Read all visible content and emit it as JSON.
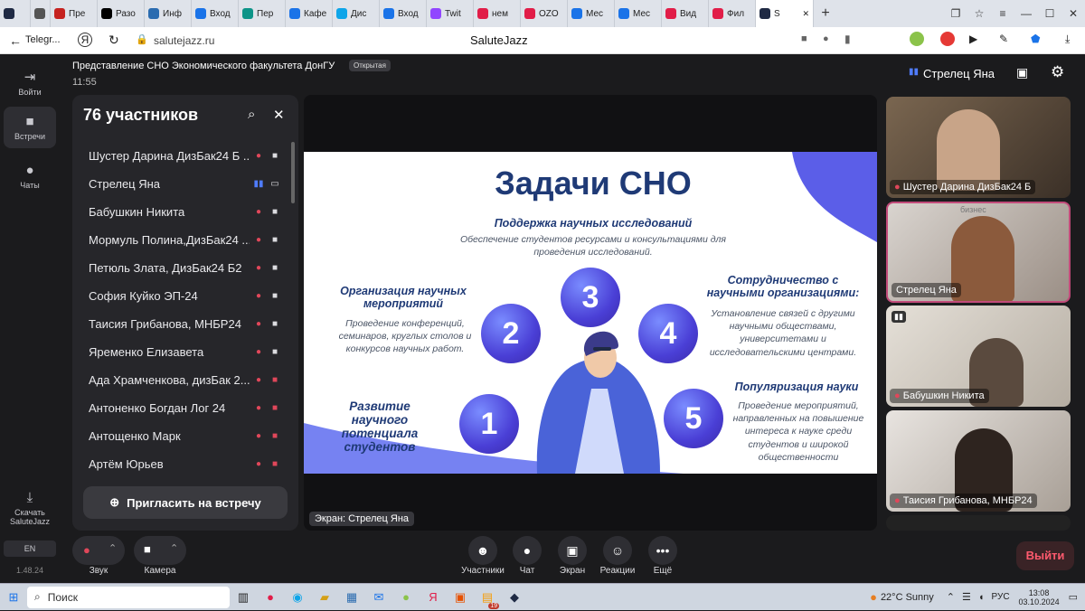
{
  "browser": {
    "tabs": [
      {
        "label": "",
        "color": "#1f2a44"
      },
      {
        "label": "",
        "color": "#555555"
      },
      {
        "label": "Пре",
        "color": "#c5221f"
      },
      {
        "label": "Разо",
        "color": "#000000"
      },
      {
        "label": "Инф",
        "color": "#2b6cb0"
      },
      {
        "label": "Вход",
        "color": "#1a73e8"
      },
      {
        "label": "Пер",
        "color": "#0d9488"
      },
      {
        "label": "Кафе",
        "color": "#1a73e8"
      },
      {
        "label": "Дис",
        "color": "#0ea5e9"
      },
      {
        "label": "Вход",
        "color": "#1a73e8"
      },
      {
        "label": "Twit",
        "color": "#9146ff"
      },
      {
        "label": "нем",
        "color": "#e11d48"
      },
      {
        "label": "OZO",
        "color": "#e11d48"
      },
      {
        "label": "Мес",
        "color": "#1a73e8"
      },
      {
        "label": "Мес",
        "color": "#1a73e8"
      },
      {
        "label": "Вид",
        "color": "#e11d48"
      },
      {
        "label": "Фил",
        "color": "#e11d48"
      },
      {
        "label": "S",
        "color": "#1f2a44"
      }
    ],
    "back_label": "Telegr...",
    "url": "salutejazz.ru",
    "page_title": "SaluteJazz"
  },
  "meeting": {
    "title": "Представление СНО Экономического факультета ДонГУ",
    "badge": "Открытая",
    "time": "11:55",
    "presenter_name": "Стрелец Яна"
  },
  "rail": {
    "leave": "Войти",
    "meetings": "Встречи",
    "chats": "Чаты",
    "download": "Скачать SaluteJazz",
    "lang": "EN",
    "version": "1.48.24"
  },
  "participants": {
    "title": "76 участников",
    "invite": "Пригласить на встречу",
    "list": [
      {
        "name": "Шустер Дарина ДизБак24 Б ...",
        "mic": "off",
        "cam": "on"
      },
      {
        "name": "Стрелец Яна",
        "mic": "on",
        "cam": "screen"
      },
      {
        "name": "Бабушкин Никита",
        "mic": "off",
        "cam": "on"
      },
      {
        "name": "Мормуль Полина,ДизБак24 ...",
        "mic": "off",
        "cam": "on"
      },
      {
        "name": "Петюль Злата, ДизБак24 Б2",
        "mic": "off",
        "cam": "on"
      },
      {
        "name": "София Куйко ЭП-24",
        "mic": "off",
        "cam": "on"
      },
      {
        "name": "Таисия Грибанова, МНБР24",
        "mic": "off",
        "cam": "on"
      },
      {
        "name": "Яременко Елизавета",
        "mic": "off",
        "cam": "on"
      },
      {
        "name": "Ада Храмченкова, дизБак 2...",
        "mic": "off",
        "cam": "off"
      },
      {
        "name": "Антоненко Богдан Лог 24",
        "mic": "off",
        "cam": "off"
      },
      {
        "name": "Антощенко Марк",
        "mic": "off",
        "cam": "off"
      },
      {
        "name": "Артём Юрьев",
        "mic": "off",
        "cam": "off"
      }
    ]
  },
  "slide": {
    "title": "Задачи СНО",
    "i1_h": "Развитие научного потенциала студентов",
    "i2_h": "Организация научных мероприятий",
    "i2_t": "Проведение конференций, семинаров, круглых столов и конкурсов научных работ.",
    "i3_h": "Поддержка научных исследований",
    "i3_t": "Обеспечение студентов ресурсами и консультациями для проведения исследований.",
    "i4_h": "Сотрудничество с научными организациями:",
    "i4_t": "Установление связей с другими научными обществами, университетами и исследовательскими центрами.",
    "i5_h": "Популяризация науки",
    "i5_t": "Проведение мероприятий, направленных на повышение интереса к науке среди студентов и широкой общественности",
    "n1": "1",
    "n2": "2",
    "n3": "3",
    "n4": "4",
    "n5": "5"
  },
  "stage_label": "Экран: Стрелец Яна",
  "tiles": [
    {
      "name": "Шустер Дарина ДизБак24 Б"
    },
    {
      "name": "Стрелец Яна"
    },
    {
      "name": "Бабушкин Никита"
    },
    {
      "name": "Таисия Грибанова, МНБР24"
    }
  ],
  "tile_bg_text": "бизнес",
  "controls": {
    "sound": "Звук",
    "camera": "Камера",
    "participants": "Участники",
    "chat": "Чат",
    "screen": "Экран",
    "reactions": "Реакции",
    "more": "Ещё",
    "exit": "Выйти"
  },
  "taskbar": {
    "search": "Поиск",
    "weather": "22°C Sunny",
    "lang": "РУС",
    "time": "13:08",
    "date": "03.10.2024",
    "badge": "19"
  }
}
